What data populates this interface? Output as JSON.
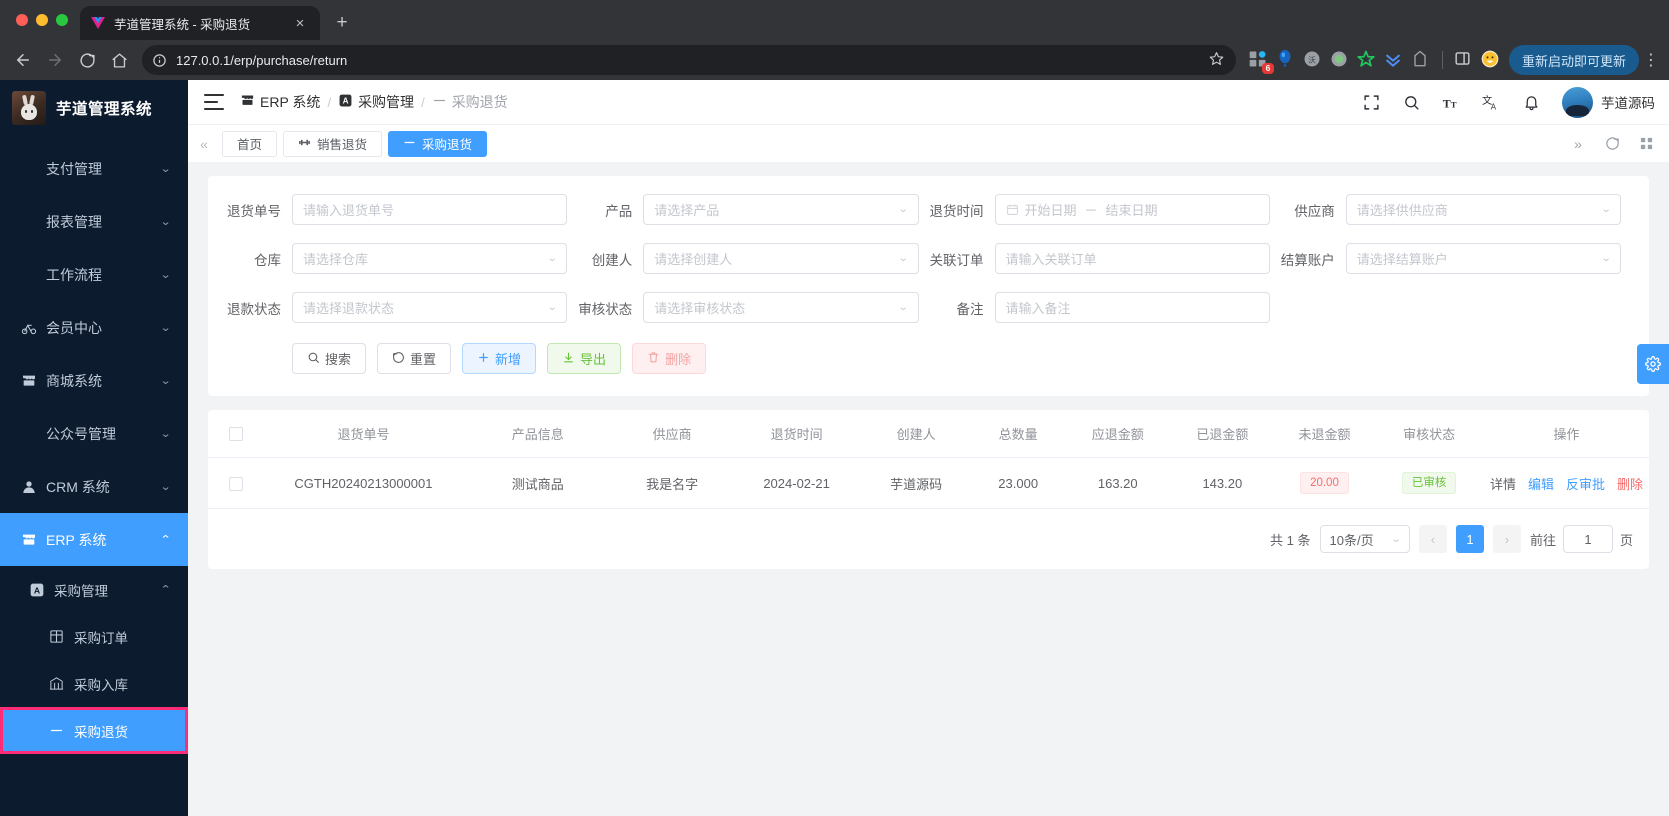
{
  "browser": {
    "tab": {
      "title": "芋道管理系统 - 采购退货",
      "favicon": "vue-logo-icon",
      "close": "×"
    },
    "newtab_label": "+",
    "url": "127.0.0.1/erp/purchase/return",
    "update_button": "重新启动即可更新",
    "extension_badge": "6",
    "nav": {
      "back": "←",
      "forward": "→",
      "reload": "⟳",
      "home": "⌂"
    }
  },
  "sidebar": {
    "logo_text": "芋道管理系统",
    "items": [
      {
        "label": "支付管理",
        "icon": "",
        "arrow": "chevron-down",
        "level": 0,
        "active": false
      },
      {
        "label": "报表管理",
        "icon": "",
        "arrow": "chevron-down",
        "level": 0,
        "active": false
      },
      {
        "label": "工作流程",
        "icon": "",
        "arrow": "chevron-down",
        "level": 0,
        "active": false
      },
      {
        "label": "会员中心",
        "icon": "bicycle-icon",
        "arrow": "chevron-down",
        "level": 0,
        "active": false
      },
      {
        "label": "商城系统",
        "icon": "shop-icon",
        "arrow": "chevron-down",
        "level": 0,
        "active": false
      },
      {
        "label": "公众号管理",
        "icon": "",
        "arrow": "chevron-down",
        "level": 0,
        "active": false
      },
      {
        "label": "CRM 系统",
        "icon": "person-icon",
        "arrow": "chevron-down",
        "level": 0,
        "active": false
      },
      {
        "label": "ERP 系统",
        "icon": "shop-icon",
        "arrow": "chevron-up",
        "level": 0,
        "active": true
      },
      {
        "label": "采购管理",
        "icon": "letter-a-icon",
        "arrow": "chevron-up",
        "level": 1,
        "active": false
      },
      {
        "label": "采购订单",
        "icon": "grid-icon",
        "arrow": "",
        "level": 2,
        "active": false
      },
      {
        "label": "采购入库",
        "icon": "warehouse-icon",
        "arrow": "",
        "level": 2,
        "active": false
      },
      {
        "label": "采购退货",
        "icon": "dash-icon",
        "arrow": "",
        "level": 2,
        "active": true,
        "highlighted": true
      }
    ]
  },
  "topbar": {
    "menu_icon": "hamburger-icon",
    "breadcrumb": [
      {
        "label": "ERP 系统",
        "icon": "shop-icon"
      },
      {
        "label": "采购管理",
        "icon": "letter-a-icon"
      },
      {
        "label": "采购退货",
        "icon": "dash-icon"
      }
    ],
    "separator": "/",
    "icons": [
      "fullscreen-icon",
      "search-icon",
      "font-size-icon",
      "translate-icon",
      "bell-icon"
    ],
    "user_name": "芋道源码"
  },
  "tabbar": {
    "collapse_icon": "«",
    "tabs": [
      {
        "label": "首页",
        "icon": "",
        "active": false
      },
      {
        "label": "销售退货",
        "icon": "dumbbell-icon",
        "active": false
      },
      {
        "label": "采购退货",
        "icon": "dash-icon",
        "active": true
      }
    ],
    "right_icons": [
      "»",
      "refresh-icon",
      "grid-icon"
    ]
  },
  "search_form": {
    "fields": [
      {
        "label": "退货单号",
        "placeholder": "请输入退货单号",
        "type": "input"
      },
      {
        "label": "产品",
        "placeholder": "请选择产品",
        "type": "select"
      },
      {
        "label": "退货时间",
        "placeholder": "",
        "type": "daterange",
        "start": "开始日期",
        "end": "结束日期",
        "dash": "－"
      },
      {
        "label": "供应商",
        "placeholder": "请选择供供应商",
        "type": "select"
      },
      {
        "label": "仓库",
        "placeholder": "请选择仓库",
        "type": "select"
      },
      {
        "label": "创建人",
        "placeholder": "请选择创建人",
        "type": "select"
      },
      {
        "label": "关联订单",
        "placeholder": "请输入关联订单",
        "type": "input"
      },
      {
        "label": "结算账户",
        "placeholder": "请选择结算账户",
        "type": "select"
      },
      {
        "label": "退款状态",
        "placeholder": "请选择退款状态",
        "type": "select"
      },
      {
        "label": "审核状态",
        "placeholder": "请选择审核状态",
        "type": "select"
      },
      {
        "label": "备注",
        "placeholder": "请输入备注",
        "type": "input"
      }
    ],
    "buttons": [
      {
        "label": "搜索",
        "icon": "search-icon",
        "style": "default"
      },
      {
        "label": "重置",
        "icon": "refresh-icon",
        "style": "default"
      },
      {
        "label": "新增",
        "icon": "plus-icon",
        "style": "primary"
      },
      {
        "label": "导出",
        "icon": "download-icon",
        "style": "success"
      },
      {
        "label": "删除",
        "icon": "trash-icon",
        "style": "danger"
      }
    ]
  },
  "table": {
    "columns": [
      "",
      "退货单号",
      "产品信息",
      "供应商",
      "退货时间",
      "创建人",
      "总数量",
      "应退金额",
      "已退金额",
      "未退金额",
      "审核状态",
      "操作"
    ],
    "rows": [
      {
        "return_no": "CGTH20240213000001",
        "product": "测试商品",
        "supplier": "我是名字",
        "return_time": "2024-02-21",
        "creator": "芋道源码",
        "total_qty": "23.000",
        "due_amount": "163.20",
        "refunded_amount": "143.20",
        "unrefunded_amount": "20.00",
        "audit_status": "已审核",
        "ops": [
          "详情",
          "编辑",
          "反审批",
          "删除"
        ]
      }
    ]
  },
  "pagination": {
    "total_text": "共 1 条",
    "page_size": "10条/页",
    "prev": "‹",
    "next": "›",
    "pages": [
      "1"
    ],
    "current_page": "1",
    "jump_label": "前往",
    "jump_value": "1",
    "jump_unit": "页"
  },
  "colors": {
    "primary": "#409eff",
    "success": "#67c23a",
    "danger": "#f56c6c",
    "sidebar_bg": "#0d1b2e",
    "highlight": "#ff2d78"
  }
}
